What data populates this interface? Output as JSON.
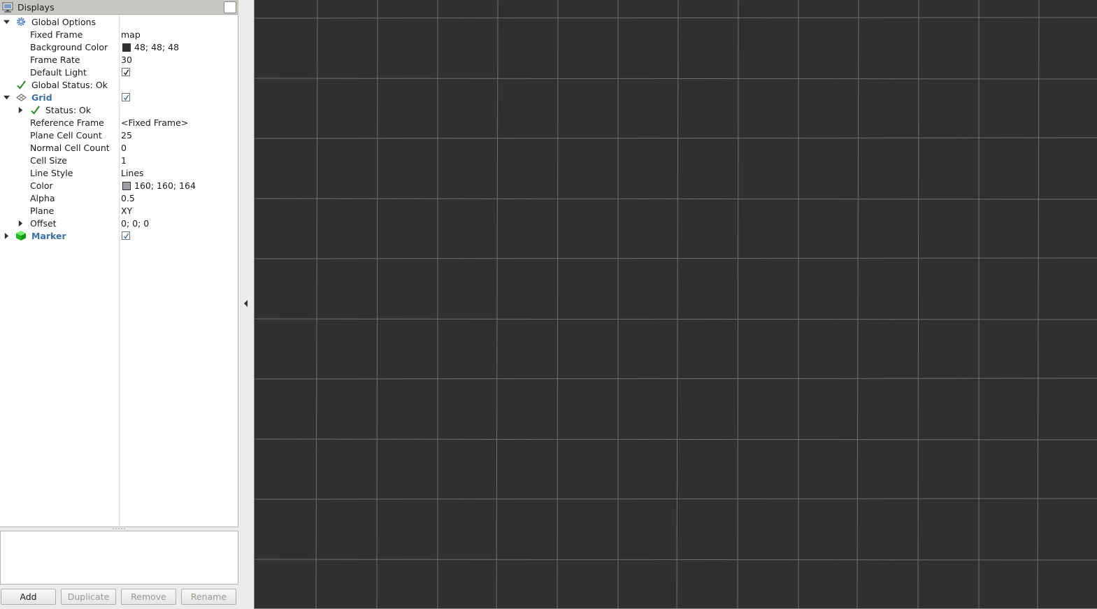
{
  "panel": {
    "title": "Displays"
  },
  "tree": {
    "global_options": {
      "label": "Global Options",
      "fixed_frame": {
        "label": "Fixed Frame",
        "value": "map"
      },
      "background_color": {
        "label": "Background Color",
        "value": "48; 48; 48",
        "swatch": "#303030"
      },
      "frame_rate": {
        "label": "Frame Rate",
        "value": "30"
      },
      "default_light": {
        "label": "Default Light",
        "checked": true
      },
      "global_status": {
        "label": "Global Status: Ok"
      }
    },
    "grid": {
      "label": "Grid",
      "checked": true,
      "status": {
        "label": "Status: Ok"
      },
      "reference_frame": {
        "label": "Reference Frame",
        "value": "<Fixed Frame>"
      },
      "plane_cell_count": {
        "label": "Plane Cell Count",
        "value": "25"
      },
      "normal_cell_count": {
        "label": "Normal Cell Count",
        "value": "0"
      },
      "cell_size": {
        "label": "Cell Size",
        "value": "1"
      },
      "line_style": {
        "label": "Line Style",
        "value": "Lines"
      },
      "color": {
        "label": "Color",
        "value": "160; 160; 164",
        "swatch": "#a0a0a4"
      },
      "alpha": {
        "label": "Alpha",
        "value": "0.5"
      },
      "plane": {
        "label": "Plane",
        "value": "XY"
      },
      "offset": {
        "label": "Offset",
        "value": "0; 0; 0"
      }
    },
    "marker": {
      "label": "Marker",
      "checked": true
    }
  },
  "buttons": {
    "add": "Add",
    "duplicate": "Duplicate",
    "remove": "Remove",
    "rename": "Rename"
  },
  "viewport": {
    "background": "#303030",
    "grid_line_color": "#6e6e6e"
  },
  "colors": {
    "category_label": "#3e6fa6",
    "status_ok": "#2e8b2e",
    "marker_icon": "#2ecc40"
  },
  "icons": {
    "panel": "monitor-icon",
    "global_options": "gear-icon",
    "global_status": "checkmark-icon",
    "grid": "grid-icon",
    "status": "checkmark-icon",
    "marker": "green-cube-icon"
  }
}
